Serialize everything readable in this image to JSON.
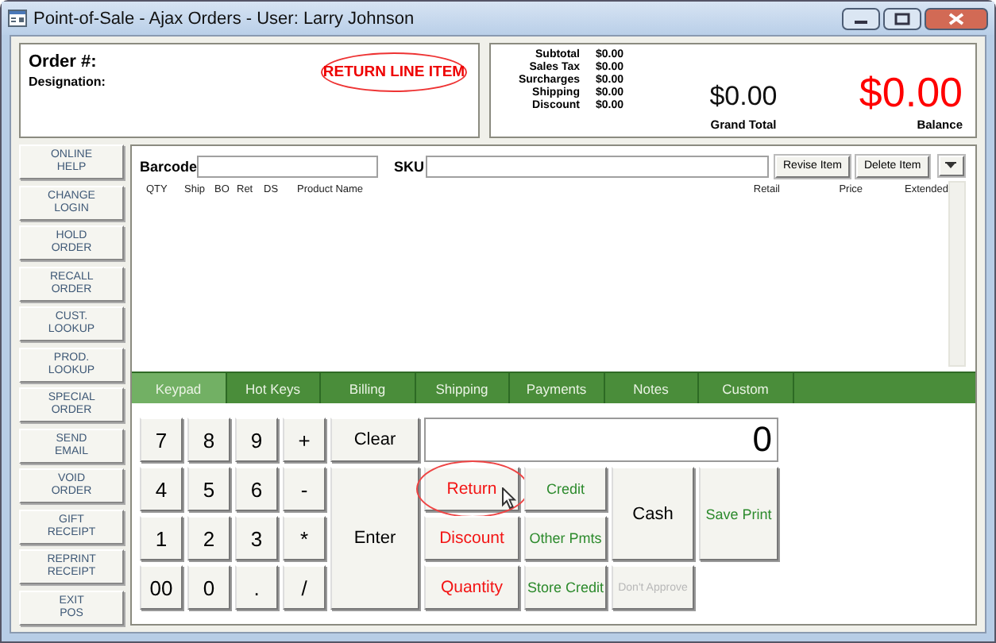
{
  "window": {
    "title": "Point-of-Sale - Ajax Orders - User: Larry Johnson"
  },
  "order": {
    "order_label": "Order #:",
    "designation_label": "Designation:",
    "callout": "RETURN LINE ITEM"
  },
  "totals": {
    "rows": [
      {
        "label": "Subtotal",
        "value": "$0.00"
      },
      {
        "label": "Sales Tax",
        "value": "$0.00"
      },
      {
        "label": "Surcharges",
        "value": "$0.00"
      },
      {
        "label": "Shipping",
        "value": "$0.00"
      },
      {
        "label": "Discount",
        "value": "$0.00"
      }
    ],
    "grand_total": "$0.00",
    "grand_total_label": "Grand Total",
    "balance": "$0.00",
    "balance_label": "Balance"
  },
  "sidebar": {
    "items": [
      "ONLINE HELP",
      "CHANGE LOGIN",
      "HOLD ORDER",
      "RECALL ORDER",
      "CUST. LOOKUP",
      "PROD. LOOKUP",
      "SPECIAL ORDER",
      "SEND EMAIL",
      "VOID ORDER",
      "GIFT RECEIPT",
      "REPRINT RECEIPT",
      "EXIT POS"
    ]
  },
  "item_entry": {
    "barcode_label": "Barcode",
    "sku_label": "SKU",
    "buttons": [
      "Revise Item",
      "Delete Item"
    ]
  },
  "columns": [
    "QTY",
    "Ship",
    "BO",
    "Ret",
    "DS",
    "Product Name",
    "Retail",
    "Price",
    "Extended"
  ],
  "tabs": [
    {
      "label": "Keypad",
      "selected": true
    },
    {
      "label": "Hot Keys",
      "selected": false
    },
    {
      "label": "Billing",
      "selected": false
    },
    {
      "label": "Shipping",
      "selected": false
    },
    {
      "label": "Payments",
      "selected": false
    },
    {
      "label": "Notes",
      "selected": false
    },
    {
      "label": "Custom",
      "selected": false
    }
  ],
  "keypad": {
    "display": "0",
    "keys": [
      {
        "label": "7",
        "kind": "digit",
        "disabled": false,
        "highlighted": false
      },
      {
        "label": "8",
        "kind": "digit",
        "disabled": false,
        "highlighted": false
      },
      {
        "label": "9",
        "kind": "digit",
        "disabled": false,
        "highlighted": false
      },
      {
        "label": "+",
        "kind": "digit",
        "disabled": false,
        "highlighted": false
      },
      {
        "label": "Clear",
        "kind": "command",
        "disabled": false,
        "highlighted": false
      },
      {
        "label": "4",
        "kind": "digit",
        "disabled": false,
        "highlighted": false
      },
      {
        "label": "5",
        "kind": "digit",
        "disabled": false,
        "highlighted": false
      },
      {
        "label": "6",
        "kind": "digit",
        "disabled": false,
        "highlighted": false
      },
      {
        "label": "-",
        "kind": "digit",
        "disabled": false,
        "highlighted": false
      },
      {
        "label": "1",
        "kind": "digit",
        "disabled": false,
        "highlighted": false
      },
      {
        "label": "2",
        "kind": "digit",
        "disabled": false,
        "highlighted": false
      },
      {
        "label": "3",
        "kind": "digit",
        "disabled": false,
        "highlighted": false
      },
      {
        "label": "*",
        "kind": "digit",
        "disabled": false,
        "highlighted": false
      },
      {
        "label": "00",
        "kind": "digit",
        "disabled": false,
        "highlighted": false
      },
      {
        "label": "0",
        "kind": "digit",
        "disabled": false,
        "highlighted": false
      },
      {
        "label": ".",
        "kind": "digit",
        "disabled": false,
        "highlighted": false
      },
      {
        "label": "/",
        "kind": "digit",
        "disabled": false,
        "highlighted": false
      },
      {
        "label": "Enter",
        "kind": "command",
        "disabled": false,
        "highlighted": false
      },
      {
        "label": "Return",
        "kind": "adjustment",
        "disabled": false,
        "highlighted": true
      },
      {
        "label": "Credit",
        "kind": "payment",
        "disabled": false,
        "highlighted": false
      },
      {
        "label": "Cash",
        "kind": "command",
        "disabled": false,
        "highlighted": false
      },
      {
        "label": "Save Print",
        "kind": "payment",
        "disabled": false,
        "highlighted": false
      },
      {
        "label": "Discount",
        "kind": "adjustment",
        "disabled": false,
        "highlighted": false
      },
      {
        "label": "Other Pmts",
        "kind": "payment",
        "disabled": false,
        "highlighted": false
      },
      {
        "label": "Quantity",
        "kind": "adjustment",
        "disabled": false,
        "highlighted": false
      },
      {
        "label": "Store Credit",
        "kind": "payment",
        "disabled": false,
        "highlighted": false
      },
      {
        "label": "Don't Approve",
        "kind": "payment",
        "disabled": true,
        "highlighted": false
      }
    ]
  }
}
